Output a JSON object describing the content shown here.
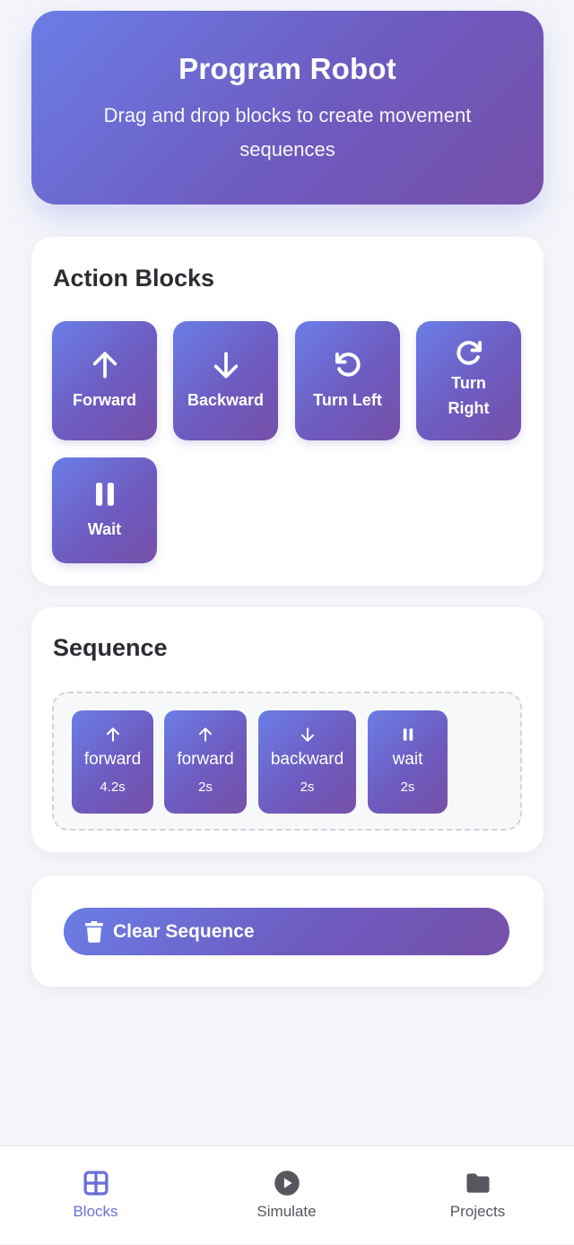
{
  "header": {
    "title": "Program Robot",
    "subtitle": "Drag and drop blocks to create movement sequences"
  },
  "action_blocks": {
    "title": "Action Blocks",
    "items": [
      {
        "label": "Forward",
        "icon": "arrow-up-icon"
      },
      {
        "label": "Backward",
        "icon": "arrow-down-icon"
      },
      {
        "label": "Turn Left",
        "icon": "rotate-left-icon"
      },
      {
        "label": "Turn Right",
        "icon": "rotate-right-icon"
      },
      {
        "label": "Wait",
        "icon": "pause-icon"
      }
    ]
  },
  "sequence": {
    "title": "Sequence",
    "items": [
      {
        "name": "forward",
        "duration": "4.2s",
        "icon": "arrow-up-icon"
      },
      {
        "name": "forward",
        "duration": "2s",
        "icon": "arrow-up-icon"
      },
      {
        "name": "backward",
        "duration": "2s",
        "icon": "arrow-down-icon"
      },
      {
        "name": "wait",
        "duration": "2s",
        "icon": "pause-icon"
      }
    ]
  },
  "controls": {
    "clear_label": "Clear Sequence",
    "clear_icon": "trash-icon"
  },
  "tabbar": {
    "tabs": [
      {
        "label": "Blocks",
        "icon": "grid-icon",
        "active": true
      },
      {
        "label": "Simulate",
        "icon": "play-circle-icon",
        "active": false
      },
      {
        "label": "Projects",
        "icon": "folder-icon",
        "active": false
      }
    ]
  },
  "colors": {
    "gradient_start": "#6a7ee6",
    "gradient_end": "#7650a8",
    "active_tab": "#6a6fd6",
    "inactive_tab": "#56565e"
  }
}
